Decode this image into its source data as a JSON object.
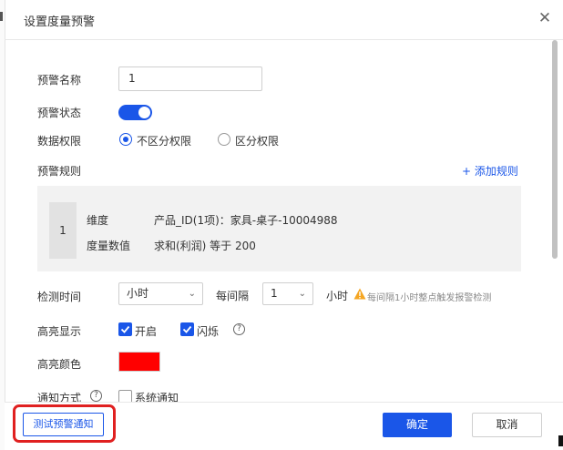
{
  "dialog": {
    "title": "设置度量预警",
    "close_glyph": "✕"
  },
  "form": {
    "name_label": "预警名称",
    "name_value": "1",
    "status_label": "预警状态",
    "status_on": true,
    "permission_label": "数据权限",
    "permission_options": [
      "不区分权限",
      "区分权限"
    ],
    "permission_selected": "不区分权限",
    "rules_label": "预警规则",
    "add_rule_link": "+ 添加规则",
    "rules": [
      {
        "index": "1",
        "dimension_label": "维度",
        "dimension_value": "产品_ID(1项)：家具-桌子-10004988",
        "measure_label": "度量数值",
        "measure_value": "求和(利润) 等于 200"
      }
    ],
    "detect_time_label": "检测时间",
    "detect_unit_select": "小时",
    "every_label": "每间隔",
    "interval_select": "1",
    "interval_unit": "小时",
    "interval_hint": "每间隔1小时整点触发报警检测",
    "highlight_label": "高亮显示",
    "highlight_enable_label": "开启",
    "highlight_enable_checked": true,
    "highlight_blink_label": "闪烁",
    "highlight_blink_checked": true,
    "help_glyph": "?",
    "highlight_color_label": "高亮颜色",
    "highlight_color": "#ff0000",
    "notify_label": "通知方式",
    "notify_system_label": "系统通知",
    "notify_system_checked": false
  },
  "footer": {
    "test_button": "测试预警通知",
    "ok_button": "确定",
    "cancel_button": "取消"
  },
  "colors": {
    "accent": "#1a56e8",
    "highlight_box": "#e02020"
  }
}
